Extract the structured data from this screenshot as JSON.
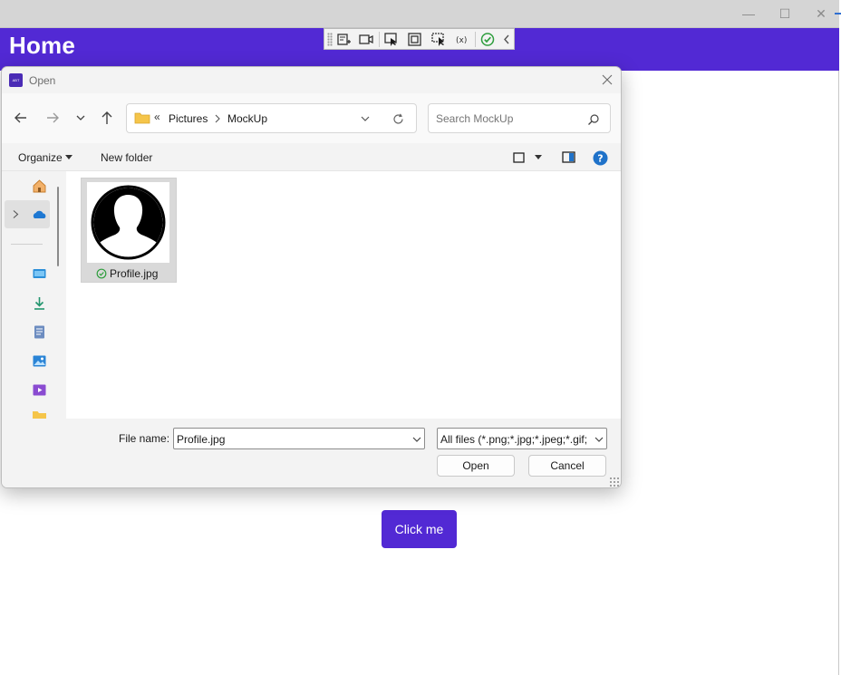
{
  "app": {
    "title": "Home",
    "click_button_label": "Click me",
    "accent_color": "#5229d4"
  },
  "window_controls": {
    "minimize": "—",
    "maximize": "☐",
    "close": "✕"
  },
  "debug_toolbar": {
    "icons": [
      "grip-icon",
      "live-visual-tree-icon",
      "video-capture-icon",
      "select-element-icon",
      "display-layout-adorners-icon",
      "track-focus-icon",
      "binding-failures-icon",
      "accessibility-check-icon",
      "collapse-toolbar-icon"
    ]
  },
  "dialog": {
    "title": "Open",
    "app_icon_text": "ABT",
    "breadcrumb": {
      "overflow": "«",
      "items": [
        "Pictures",
        "MockUp"
      ]
    },
    "search_placeholder": "Search MockUp",
    "commands": {
      "organize": "Organize",
      "new_folder": "New folder"
    },
    "nav_pane_icons": [
      "home-icon",
      "onedrive-icon",
      "desktop-icon",
      "downloads-icon",
      "documents-icon",
      "pictures-icon",
      "videos-icon",
      "folder-icon"
    ],
    "files": [
      {
        "name": "Profile.jpg",
        "status": "synced"
      }
    ],
    "file_name_label": "File name:",
    "file_name_value": "Profile.jpg",
    "filter": "All files (*.png;*.jpg;*.jpeg;*.gif;",
    "open_label": "Open",
    "cancel_label": "Cancel"
  }
}
